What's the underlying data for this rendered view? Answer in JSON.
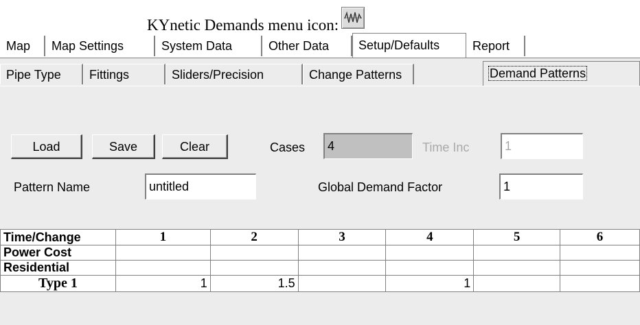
{
  "caption": {
    "text": "KYnetic Demands menu icon:",
    "icon": "waveform-icon"
  },
  "main_tabs": [
    "Map",
    "Map Settings",
    "System Data",
    "Other Data",
    "Setup/Defaults",
    "Report"
  ],
  "main_tabs_active": "Setup/Defaults",
  "sub_tabs": [
    "Pipe Type",
    "Fittings",
    "Sliders/Precision",
    "Change Patterns",
    "Demand Patterns"
  ],
  "sub_tabs_active": "Demand Patterns",
  "buttons": {
    "load": "Load",
    "save": "Save",
    "clear": "Clear"
  },
  "fields": {
    "cases_label": "Cases",
    "cases_value": "4",
    "time_inc_label": "Time Inc",
    "time_inc_value": "1",
    "pattern_name_label": "Pattern Name",
    "pattern_name_value": "untitled",
    "global_demand_factor_label": "Global Demand Factor",
    "global_demand_factor_value": "1"
  },
  "grid": {
    "corner": "Time/Change",
    "columns": [
      "1",
      "2",
      "3",
      "4",
      "5",
      "6"
    ],
    "rows": [
      {
        "label": "Power Cost",
        "cells": [
          "",
          "",
          "",
          "",
          "",
          ""
        ]
      },
      {
        "label": "Residential",
        "cells": [
          "",
          "",
          "",
          "",
          "",
          ""
        ]
      },
      {
        "label": "Type 1",
        "cells": [
          "1",
          "1.5",
          "",
          "1",
          "",
          ""
        ]
      }
    ]
  },
  "colors": {
    "panel": "#ececec",
    "disabled_text": "#a9a9a9",
    "gray_field": "#c0c0c0"
  }
}
